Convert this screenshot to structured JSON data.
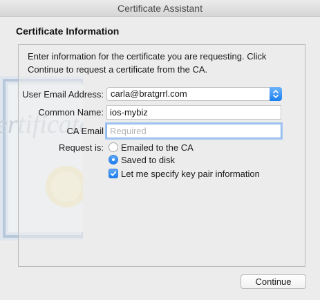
{
  "window": {
    "title": "Certificate Assistant"
  },
  "heading": "Certificate Information",
  "intro": "Enter information for the certificate you are requesting. Click Continue to request a certificate from the CA.",
  "form": {
    "email_label": "User Email Address:",
    "email_value": "carla@bratgrrl.com",
    "common_name_label": "Common Name:",
    "common_name_value": "ios-mybiz",
    "ca_email_label": "CA Email",
    "ca_email_placeholder": "Required",
    "ca_email_value": "",
    "request_label": "Request is:",
    "request_options": [
      {
        "label": "Emailed to the CA",
        "selected": false
      },
      {
        "label": "Saved to disk",
        "selected": true
      }
    ],
    "keypair_label": "Let me specify key pair information",
    "keypair_checked": true
  },
  "buttons": {
    "continue_label": "Continue"
  },
  "background_art": {
    "text": "ertificate"
  },
  "icons": {
    "popup_arrow": "chevron-updown-icon",
    "checkmark": "checkmark-icon"
  },
  "colors": {
    "accent": "#1c7ef0",
    "focus_ring": "#a5c7f3"
  }
}
